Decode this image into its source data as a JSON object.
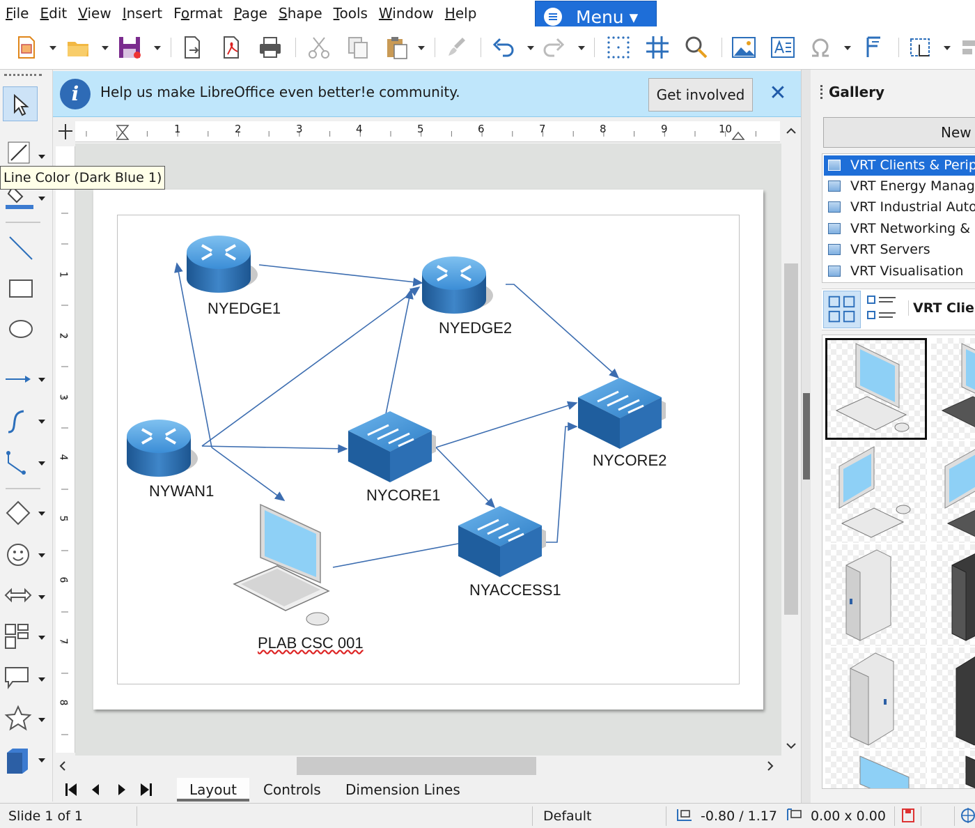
{
  "menubar": {
    "items": [
      {
        "prefix": "",
        "ul": "F",
        "rest": "ile"
      },
      {
        "prefix": "",
        "ul": "E",
        "rest": "dit"
      },
      {
        "prefix": "",
        "ul": "V",
        "rest": "iew"
      },
      {
        "prefix": "",
        "ul": "I",
        "rest": "nsert"
      },
      {
        "prefix": "F",
        "ul": "o",
        "rest": "rmat"
      },
      {
        "prefix": "",
        "ul": "P",
        "rest": "age"
      },
      {
        "prefix": "",
        "ul": "S",
        "rest": "hape"
      },
      {
        "prefix": "",
        "ul": "T",
        "rest": "ools"
      },
      {
        "prefix": "",
        "ul": "W",
        "rest": "indow"
      },
      {
        "prefix": "",
        "ul": "H",
        "rest": "elp"
      }
    ],
    "menu_button": "Menu ▾"
  },
  "tooltip": "Line Color (Dark Blue 1)",
  "infobar": {
    "message": "Help us make LibreOffice even better!e community.",
    "button": "Get involved",
    "close": "✕"
  },
  "hruler": {
    "numbers": [
      "1",
      "2",
      "3",
      "4",
      "5",
      "6",
      "7",
      "8",
      "9",
      "10"
    ]
  },
  "vruler": {
    "numbers": [
      "1",
      "2",
      "3",
      "4",
      "5",
      "6",
      "7",
      "8"
    ]
  },
  "diagram": {
    "nodes": {
      "nyedge1": "NYEDGE1",
      "nyedge2": "NYEDGE2",
      "nywan1": "NYWAN1",
      "nycore1": "NYCORE1",
      "nycore2": "NYCORE2",
      "nyaccess1": "NYACCESS1",
      "plab": "PLAB CSC 001"
    },
    "colors": {
      "connector": "#3c6db0",
      "device_top": "#5ba3e0",
      "device_side": "#1f5e9e"
    }
  },
  "tabs": {
    "layout": "Layout",
    "controls": "Controls",
    "dimension_lines": "Dimension Lines"
  },
  "gallery": {
    "title": "Gallery",
    "new_theme": "New Theme...",
    "themes": [
      "VRT Clients & Peripherals",
      "VRT Energy Management",
      "VRT Industrial Automation",
      "VRT Networking & Communication",
      "VRT Servers",
      "VRT Visualisation"
    ],
    "current_theme_label": "VRT Clients & Peripherals"
  },
  "statusbar": {
    "slide": "Slide 1 of 1",
    "layout": "Default",
    "position": "-0.80 / 1.17",
    "size": "0.00 x 0.00"
  },
  "colors": {
    "accent": "#1e6ed8",
    "infobar": "#bfe6fb"
  }
}
